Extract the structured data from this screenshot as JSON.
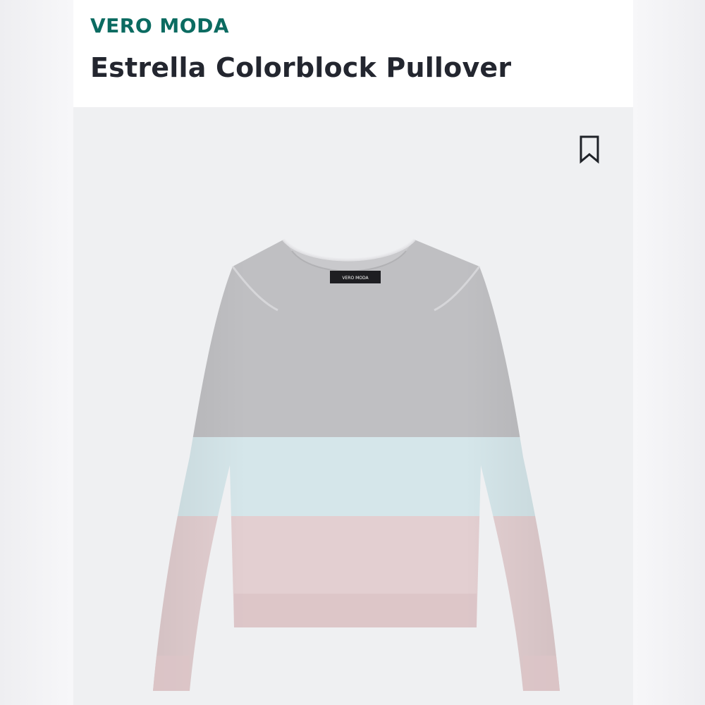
{
  "product": {
    "brand": "VERO MODA",
    "title": "Estrella Colorblock Pullover"
  },
  "image": {
    "neck_label": "VERO MODA"
  },
  "icons": {
    "bookmark": "bookmark-icon"
  },
  "colors": {
    "brand": "#0b6b61",
    "title": "#23262f",
    "gray_block": "#bfbfc2",
    "blue_block": "#d5e6ea",
    "pink_block": "#e3cfd1"
  }
}
